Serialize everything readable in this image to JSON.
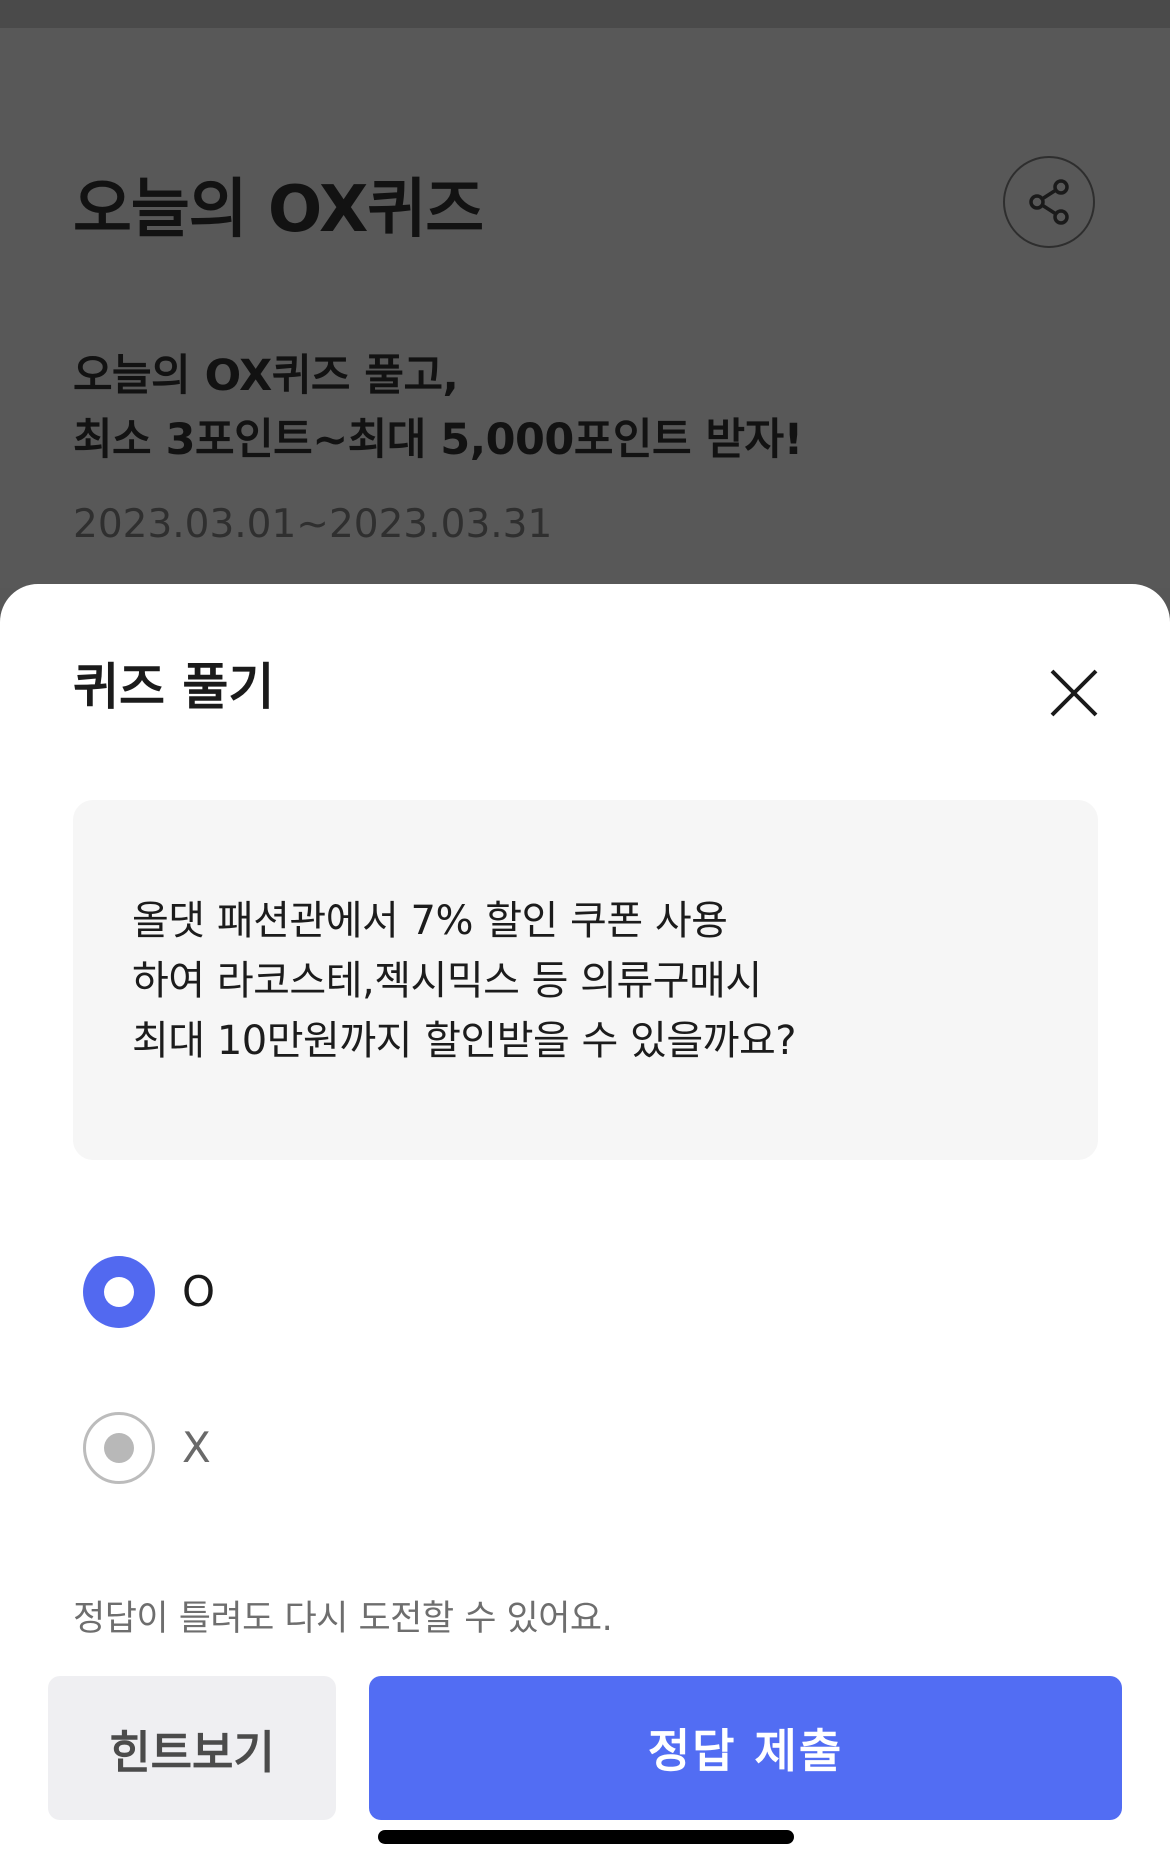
{
  "header": {
    "title": "오늘의 OX퀴즈",
    "share_icon": "share-icon"
  },
  "promo": {
    "line1": "오늘의 OX퀴즈 풀고,",
    "line2": "최소 3포인트~최대 5,000포인트 받자!",
    "period": "2023.03.01~2023.03.31"
  },
  "sheet": {
    "title": "퀴즈 풀기",
    "close_icon": "close-icon",
    "question": {
      "line1": "올댓 패션관에서 7% 할인 쿠폰 사용",
      "line2": "하여 라코스테,젝시믹스 등 의류구매시",
      "line3": "최대 10만원까지 할인받을 수 있을까요?"
    },
    "options": [
      {
        "label": "O",
        "selected": true
      },
      {
        "label": "X",
        "selected": false
      }
    ],
    "notice": "정답이 틀려도 다시 도전할 수 있어요.",
    "hint_button": "힌트보기",
    "submit_button": "정답 제출"
  },
  "colors": {
    "accent": "#526df3",
    "overlay": "#575757",
    "sheet_bg": "#ffffff",
    "question_bg": "#f6f6f6",
    "hint_bg": "#efeff2"
  }
}
